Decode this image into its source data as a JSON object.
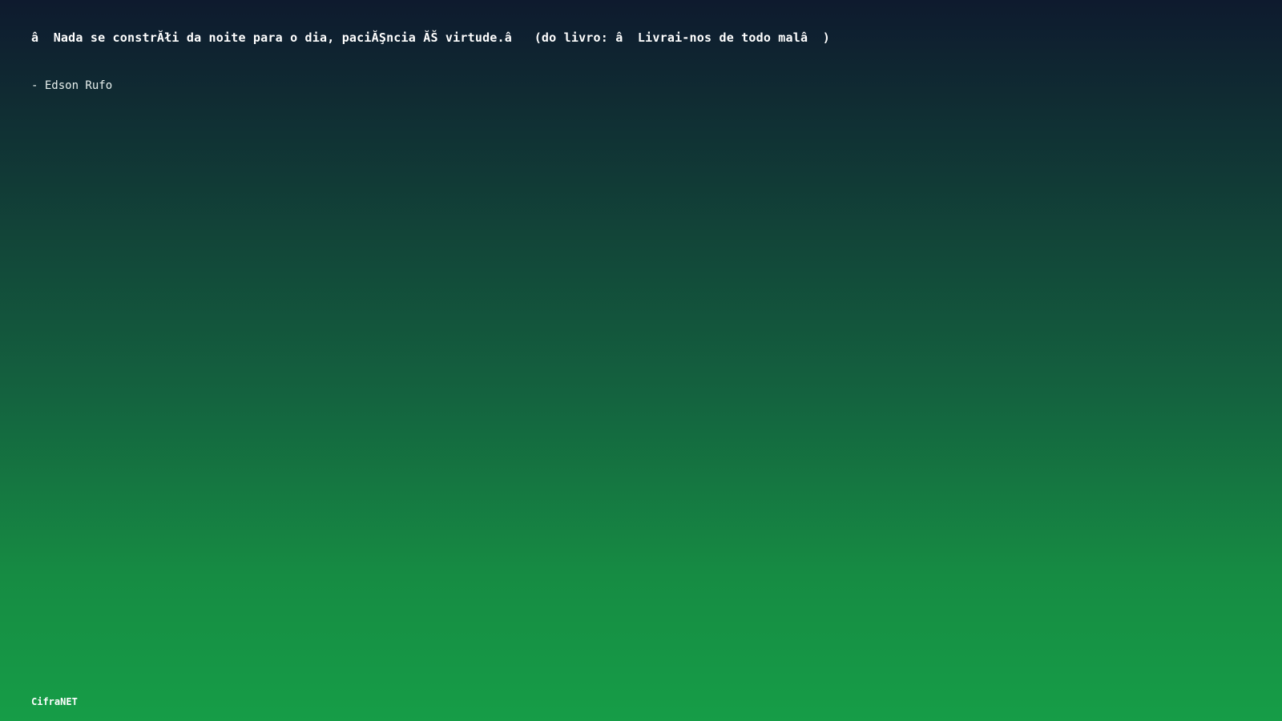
{
  "quote": {
    "text": "â  Nada se constrĂłi da noite para o dia, paciĂŞncia ĂŠ virtude.â   (do livro: â  Livrai-nos de todo malâ  )"
  },
  "author": {
    "text": "- Edson Rufo"
  },
  "footer": {
    "brand": "CifraNET"
  },
  "colors": {
    "background_top": "#0e1a2e",
    "background_bottom": "#169d47",
    "text": "#ffffff"
  }
}
